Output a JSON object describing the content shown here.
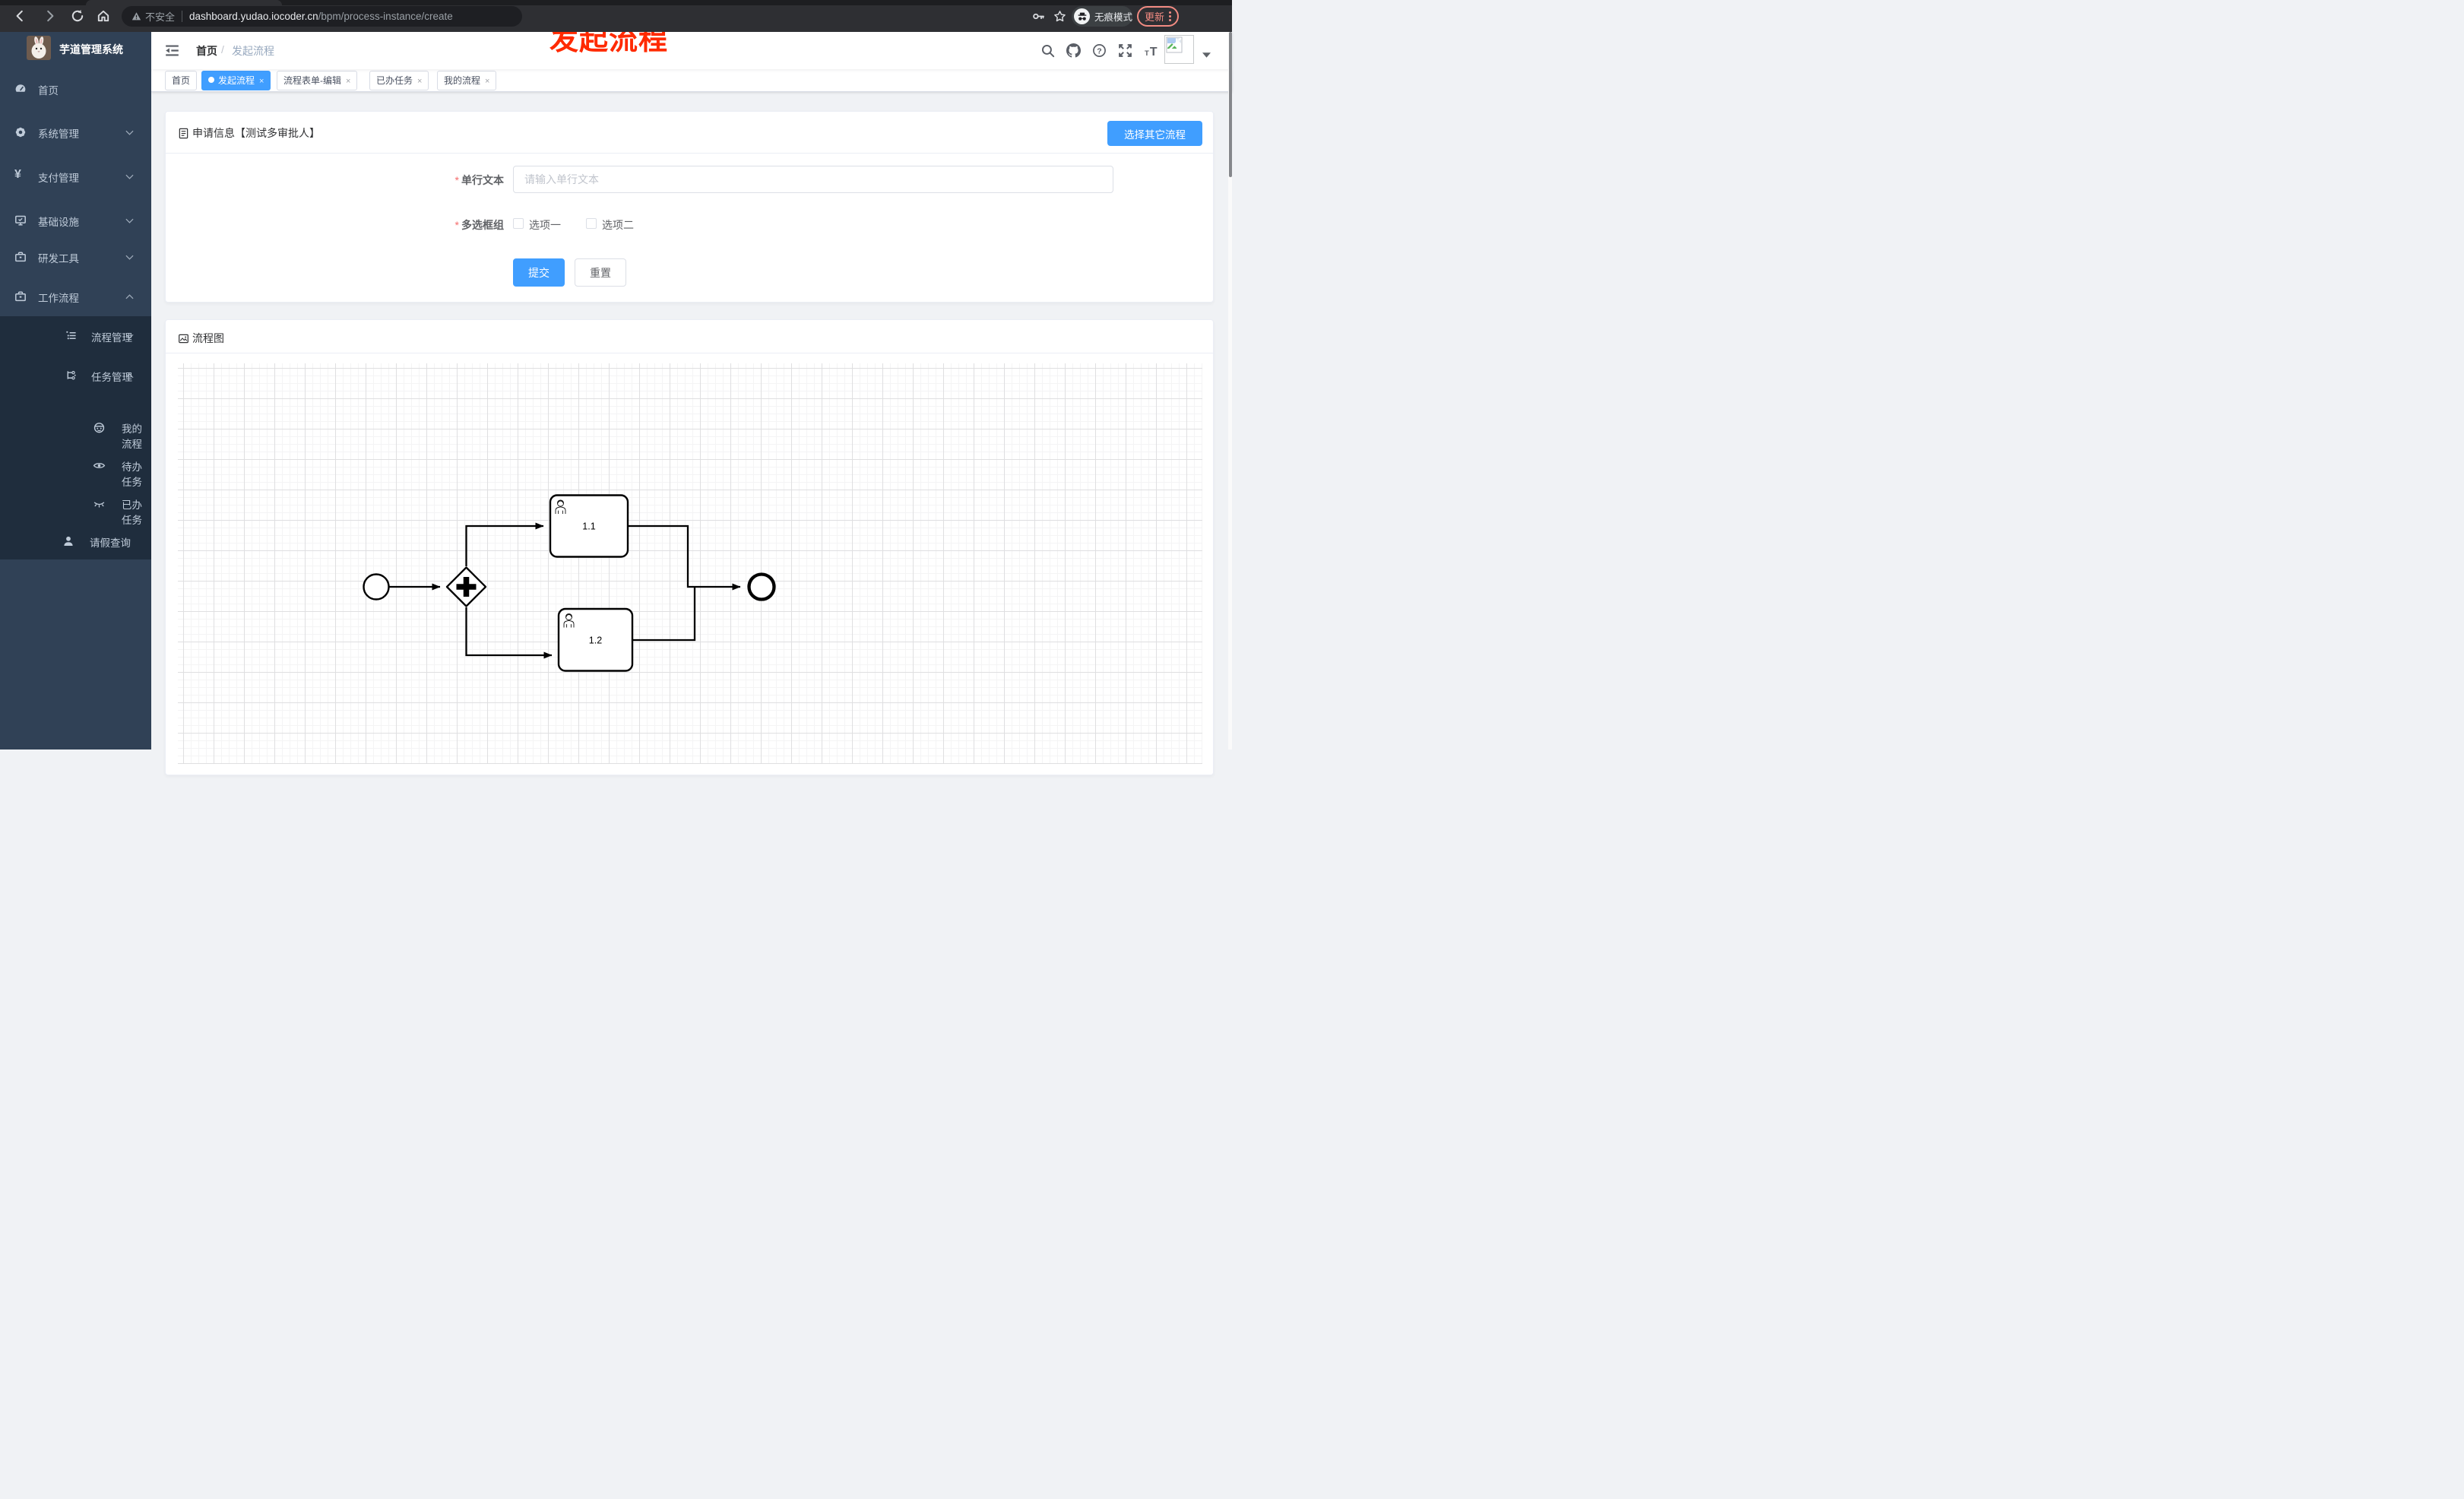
{
  "colors": {
    "accent": "#409eff",
    "danger": "#f56c6c",
    "update_button": "#f28b82",
    "sidebar_bg": "#304156",
    "submenu_bg": "#1f2d3d",
    "annotation": "#ff2a00"
  },
  "browser": {
    "security_label": "不安全",
    "url_host": "dashboard.yudao.iocoder.cn",
    "url_path": "/bpm/process-instance/create",
    "incognito_label": "无痕模式",
    "update_label": "更新"
  },
  "annotation": {
    "text": "发起流程"
  },
  "sidebar": {
    "title": "芋道管理系统",
    "items": [
      {
        "label": "首页",
        "icon": "dashboard-icon"
      },
      {
        "label": "系统管理",
        "icon": "gear-icon",
        "chevron": "down"
      },
      {
        "label": "支付管理",
        "icon": "yen-icon",
        "chevron": "down"
      },
      {
        "label": "基础设施",
        "icon": "monitor-icon",
        "chevron": "down"
      },
      {
        "label": "研发工具",
        "icon": "toolbox-icon",
        "chevron": "down"
      },
      {
        "label": "工作流程",
        "icon": "toolbox-icon",
        "chevron": "up",
        "expanded": true
      },
      {
        "label": "流程管理",
        "icon": "list-icon",
        "chevron": "down"
      },
      {
        "label": "任务管理",
        "icon": "tasks-icon",
        "chevron": "up",
        "expanded": true
      },
      {
        "label": "我的流程",
        "icon": "robot-icon"
      },
      {
        "label": "待办任务",
        "icon": "eye-icon"
      },
      {
        "label": "已办任务",
        "icon": "eye-closed-icon"
      },
      {
        "label": "请假查询",
        "icon": "user-icon"
      }
    ]
  },
  "header": {
    "breadcrumb_home": "首页",
    "separator": "/",
    "breadcrumb_current": "发起流程"
  },
  "tabs": {
    "close_glyph": "×",
    "items": [
      {
        "label": "首页",
        "active": false,
        "closable": false
      },
      {
        "label": "发起流程",
        "active": true,
        "closable": true
      },
      {
        "label": "流程表单-编辑",
        "active": false,
        "closable": true
      },
      {
        "label": "已办任务",
        "active": false,
        "closable": true
      },
      {
        "label": "我的流程",
        "active": false,
        "closable": true
      }
    ]
  },
  "apply_card": {
    "title": "申请信息【测试多审批人】",
    "select_other_label": "选择其它流程",
    "required_mark": "*",
    "text_field": {
      "label": "单行文本",
      "placeholder": "请输入单行文本",
      "value": ""
    },
    "checkbox_field": {
      "label": "多选框组",
      "options": [
        {
          "label": "选项一",
          "checked": false
        },
        {
          "label": "选项二",
          "checked": false
        }
      ]
    },
    "submit_label": "提交",
    "reset_label": "重置"
  },
  "diagram_card": {
    "title": "流程图",
    "diagram": {
      "type": "bpmn",
      "nodes": [
        {
          "id": "start",
          "kind": "start-event"
        },
        {
          "id": "gateway",
          "kind": "parallel-gateway"
        },
        {
          "id": "task-1",
          "kind": "user-task",
          "label": "1.1"
        },
        {
          "id": "task-2",
          "kind": "user-task",
          "label": "1.2"
        },
        {
          "id": "end",
          "kind": "end-event"
        }
      ],
      "flows": [
        "start→gateway",
        "gateway→task-1",
        "gateway→task-2",
        "task-1→end",
        "task-2→end"
      ]
    }
  }
}
